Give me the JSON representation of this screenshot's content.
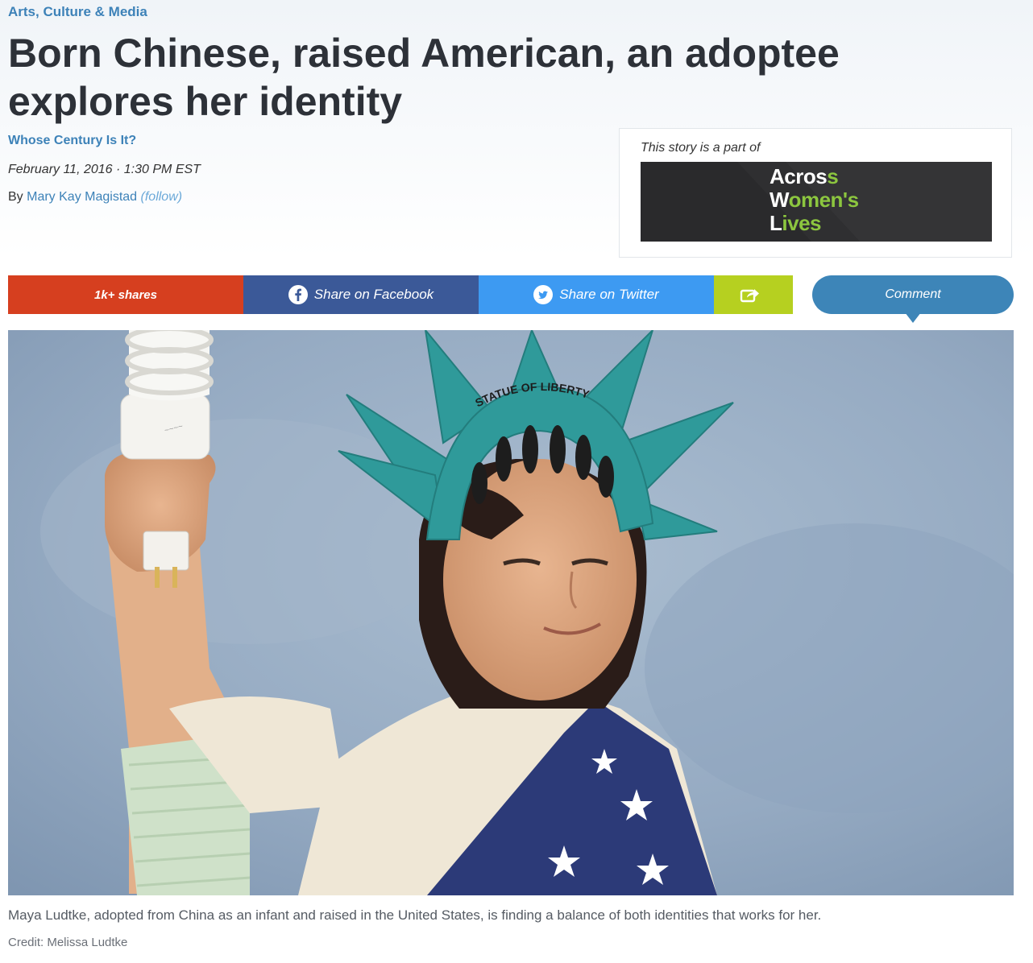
{
  "article": {
    "category": "Arts, Culture & Media",
    "headline": "Born Chinese, raised American, an adoptee explores her identity",
    "series_link": "Whose Century Is It?",
    "dateline": "February 11, 2016 · 1:30 PM EST",
    "byline_prefix": "By",
    "author": "Mary Kay Magistad",
    "follow_label": "(follow)"
  },
  "story_box": {
    "label": "This story is a part of",
    "logo_line1": "Acros",
    "logo_line1_accent": "s",
    "logo_line2_start": "W",
    "logo_line2_accent": "o",
    "logo_line2_rest": "men's",
    "logo_line3_start": "L",
    "logo_line3_accent": "ives",
    "logo_alt": "Across Women's Lives"
  },
  "share_bar": {
    "shares_count": "1k+ shares",
    "facebook_label": "Share on Facebook",
    "twitter_label": "Share on Twitter",
    "comment_label": "Comment"
  },
  "hero_image": {
    "caption": "Maya Ludtke, adopted from China as an infant and raised in the United States, is finding a balance of both identities that works for her.",
    "credit": "Credit: Melissa Ludtke",
    "crown_text": "STATUE OF LIBERTY"
  },
  "colors": {
    "link_blue": "#3d82b8",
    "shares_red": "#d63f1f",
    "facebook_blue": "#3b5998",
    "twitter_blue": "#3d9af2",
    "share_green": "#b6d020",
    "logo_green": "#8cc63f"
  },
  "icons": {
    "facebook": "facebook-icon",
    "twitter": "twitter-icon",
    "share": "share-arrow-icon"
  }
}
